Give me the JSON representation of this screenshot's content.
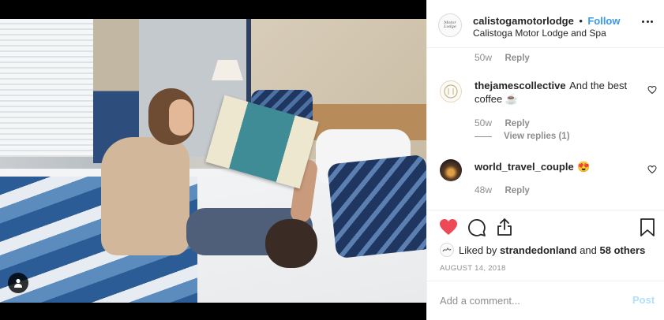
{
  "post": {
    "username": "calistogamotorlodge",
    "separator": "•",
    "follow_label": "Follow",
    "location": "Calistoga Motor Lodge and Spa",
    "avatar_text": "Motor Lodge"
  },
  "comments": [
    {
      "username": "",
      "text": "",
      "age": "50w",
      "reply_label": "Reply"
    },
    {
      "username": "thejamescollective",
      "text": "And the best coffee ☕",
      "age": "50w",
      "reply_label": "Reply",
      "view_replies": "View replies (1)"
    },
    {
      "username": "world_travel_couple",
      "text": "😍",
      "age": "48w",
      "reply_label": "Reply"
    }
  ],
  "likes": {
    "prefix": "Liked by",
    "liker": "strandedonland",
    "middle": "and",
    "others": "58 others"
  },
  "date": "AUGUST 14, 2018",
  "comment_input": {
    "placeholder": "Add a comment..."
  },
  "post_button": "Post",
  "colors": {
    "like_red": "#ed4956",
    "link_blue": "#3897f0",
    "muted": "#8e8e8e",
    "post_disabled": "#b2dffc"
  },
  "icons": [
    "heart-icon",
    "comment-icon",
    "share-icon",
    "bookmark-icon",
    "more-icon",
    "user-tag-icon"
  ]
}
